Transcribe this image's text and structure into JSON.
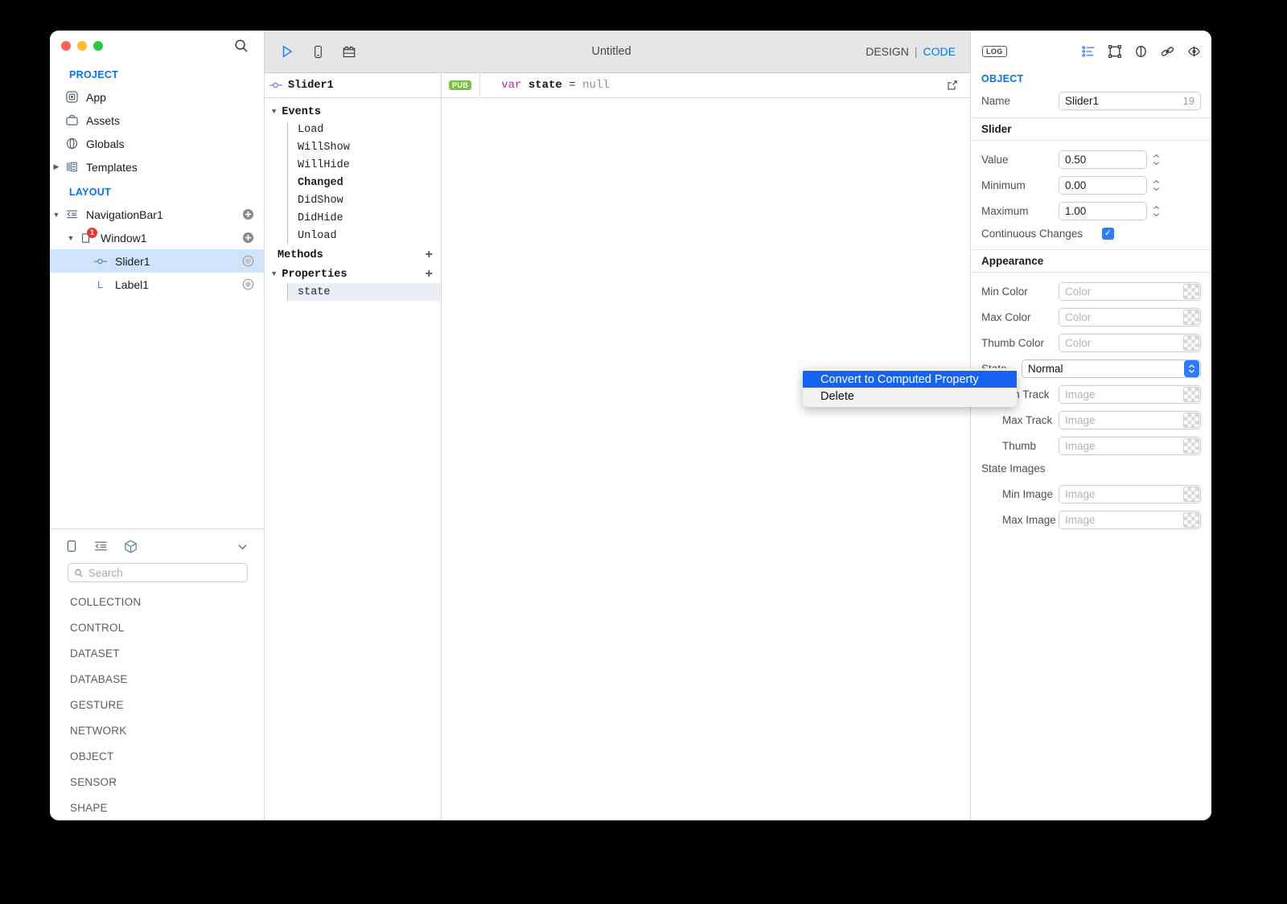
{
  "window": {
    "traffic_lights": [
      "close",
      "minimize",
      "zoom"
    ]
  },
  "sidebar": {
    "search_icon": "search-icon",
    "project": {
      "title": "PROJECT",
      "items": [
        {
          "label": "App",
          "icon": "app-icon"
        },
        {
          "label": "Assets",
          "icon": "briefcase-icon"
        },
        {
          "label": "Globals",
          "icon": "globals-icon"
        },
        {
          "label": "Templates",
          "icon": "templates-icon",
          "twisty": "▶"
        }
      ]
    },
    "layout": {
      "title": "LAYOUT",
      "items": [
        {
          "label": "NavigationBar1",
          "icon": "navbar-icon",
          "twisty": "▼",
          "trail": "add-icon",
          "depth": 0
        },
        {
          "label": "Window1",
          "icon": "window-icon",
          "twisty": "▼",
          "trail": "add-icon",
          "depth": 1,
          "badge": "1"
        },
        {
          "label": "Slider1",
          "icon": "slider-icon",
          "trail": "target-icon",
          "depth": 2,
          "selected": true
        },
        {
          "label": "Label1",
          "icon": "label-icon",
          "trail": "target-icon",
          "depth": 2
        }
      ]
    }
  },
  "library": {
    "tabs": [
      "pane-icon",
      "list-icon",
      "cube-icon"
    ],
    "collapse_icon": "chevron-down-icon",
    "search": {
      "placeholder": "Search",
      "value": ""
    },
    "categories": [
      "COLLECTION",
      "CONTROL",
      "DATASET",
      "DATABASE",
      "GESTURE",
      "NETWORK",
      "OBJECT",
      "SENSOR",
      "SHAPE"
    ]
  },
  "toolbar": {
    "run_icon": "play-icon",
    "device_icon": "phone-icon",
    "modules_icon": "blocks-icon",
    "title": "Untitled",
    "design_label": "DESIGN",
    "separator": "|",
    "code_label": "CODE"
  },
  "navigator": {
    "object_name": "Slider1",
    "object_icon": "slider-icon",
    "groups": [
      {
        "name": "Events",
        "twisty": "▼",
        "plus": "",
        "items": [
          {
            "label": "Load",
            "bold": false
          },
          {
            "label": "WillShow",
            "bold": false
          },
          {
            "label": "WillHide",
            "bold": false
          },
          {
            "label": "Changed",
            "bold": true
          },
          {
            "label": "DidShow",
            "bold": false
          },
          {
            "label": "DidHide",
            "bold": false
          },
          {
            "label": "Unload",
            "bold": false
          }
        ]
      },
      {
        "name": "Methods",
        "twisty": "",
        "plus": "+",
        "items": []
      },
      {
        "name": "Properties",
        "twisty": "▼",
        "plus": "+",
        "items": [
          {
            "label": "state",
            "selected": true
          }
        ]
      }
    ]
  },
  "code": {
    "badge": "PUB",
    "keyword": "var",
    "identifier": "state",
    "operator": "=",
    "value": "null",
    "expand_icon": "open-external-icon"
  },
  "context_menu": {
    "items": [
      {
        "label": "Convert to Computed Property",
        "highlighted": true
      },
      {
        "label": "Delete",
        "highlighted": false
      }
    ]
  },
  "inspector": {
    "log_chip": "LOG",
    "icons": [
      "properties-list-icon",
      "layout-frame-icon",
      "appearance-icon",
      "links-icon",
      "preview-icon"
    ],
    "object_label": "OBJECT",
    "name_row": {
      "label": "Name",
      "value": "Slider1",
      "suffix": "19"
    },
    "slider_section": {
      "title": "Slider",
      "rows": [
        {
          "label": "Value",
          "value": "0.50",
          "type": "stepper"
        },
        {
          "label": "Minimum",
          "value": "0.00",
          "type": "stepper"
        },
        {
          "label": "Maximum",
          "value": "1.00",
          "type": "stepper"
        }
      ],
      "checkbox_row": {
        "label": "Continuous Changes",
        "checked": true,
        "check_glyph": "✓"
      }
    },
    "appearance_section": {
      "title": "Appearance",
      "color_rows": [
        {
          "label": "Min Color",
          "placeholder": "Color"
        },
        {
          "label": "Max Color",
          "placeholder": "Color"
        },
        {
          "label": "Thumb Color",
          "placeholder": "Color"
        }
      ],
      "state_row": {
        "label": "State",
        "value": "Normal"
      },
      "track_rows": [
        {
          "label": "Min Track",
          "placeholder": "Image"
        },
        {
          "label": "Max Track",
          "placeholder": "Image"
        },
        {
          "label": "Thumb",
          "placeholder": "Image"
        }
      ],
      "state_images_label": "State Images",
      "image_rows": [
        {
          "label": "Min Image",
          "placeholder": "Image"
        },
        {
          "label": "Max Image",
          "placeholder": "Image"
        }
      ]
    }
  },
  "colors": {
    "accent_blue": "#0a72f0",
    "selection_blue": "#cfe3fb",
    "menu_highlight": "#1464f0",
    "pub_green": "#7ac143",
    "badge_red": "#e8392e",
    "toolbar_gray": "#e6e6e6"
  }
}
